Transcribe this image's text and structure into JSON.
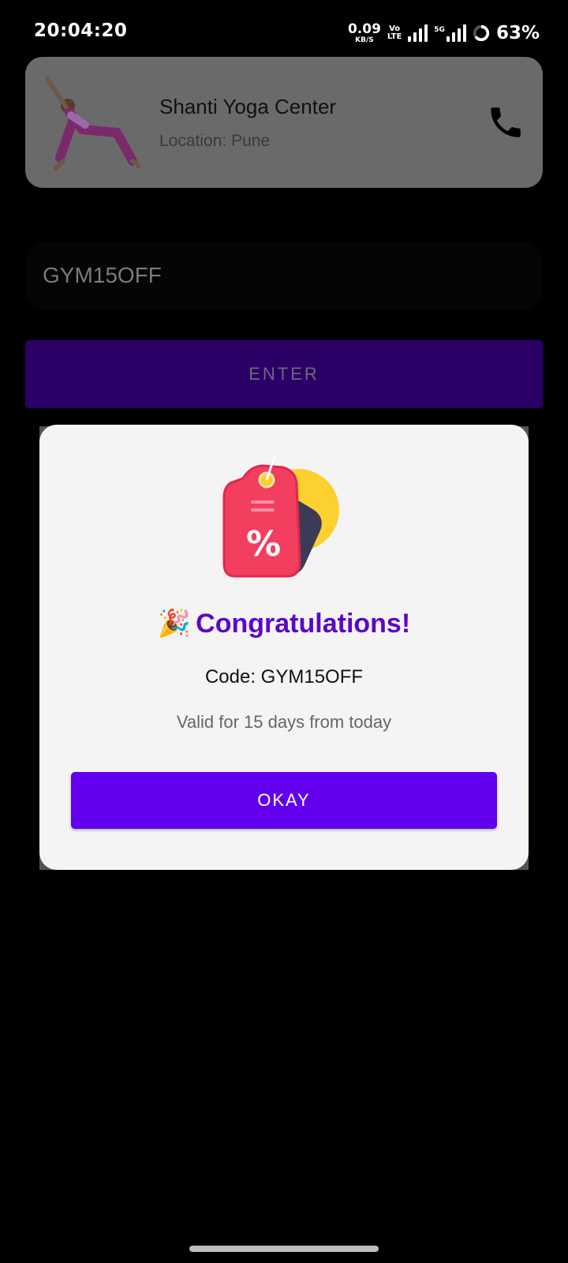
{
  "status_bar": {
    "time": "20:04:20",
    "net_speed_value": "0.09",
    "net_speed_unit": "KB/S",
    "volte_top": "Vo",
    "volte_bottom": "LTE",
    "fiveg_label": "5G",
    "battery_percent": "63%"
  },
  "center_card": {
    "name": "Shanti Yoga Center",
    "location": "Location: Pune"
  },
  "coupon": {
    "value": "GYM15OFF",
    "enter_label": "ENTER"
  },
  "dialog": {
    "party_emoji": "🎉",
    "title": "Congratulations!",
    "code_text": "Code: GYM15OFF",
    "validity_text": "Valid for 15 days from today",
    "okay_label": "OKAY"
  },
  "colors": {
    "accent": "#6200ee",
    "title_purple": "#5b06c9",
    "card_dim": "#6a6a6a"
  },
  "icons": {
    "call": "phone-icon",
    "illustration": "discount-tag-icon",
    "figure": "yoga-figure-icon"
  }
}
